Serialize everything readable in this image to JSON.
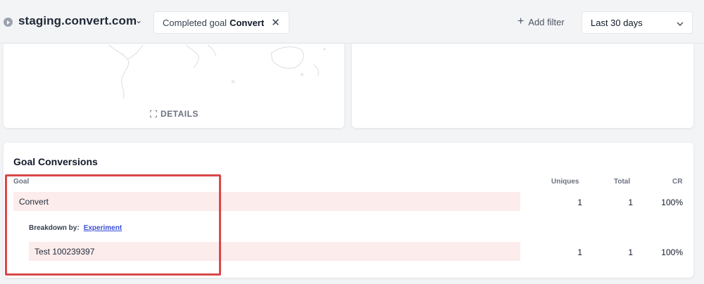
{
  "header": {
    "site_name": "staging.convert.com",
    "filter_prefix": "Completed goal",
    "filter_value": "Convert",
    "add_filter_label": "Add filter",
    "date_range": "Last 30 days"
  },
  "map_card": {
    "details_label": "DETAILS"
  },
  "goal_conversions": {
    "title": "Goal Conversions",
    "columns": [
      "Goal",
      "Uniques",
      "Total",
      "CR"
    ],
    "rows": [
      {
        "goal": "Convert",
        "uniques": "1",
        "total": "1",
        "cr": "100%"
      }
    ],
    "breakdown_label": "Breakdown by:",
    "breakdown_value": "Experiment",
    "breakdown_rows": [
      {
        "goal": "Test 100239397",
        "uniques": "1",
        "total": "1",
        "cr": "100%"
      }
    ]
  },
  "colors": {
    "highlight_border": "#d94848",
    "row_band": "#fdecec",
    "link": "#3b4fd8"
  }
}
